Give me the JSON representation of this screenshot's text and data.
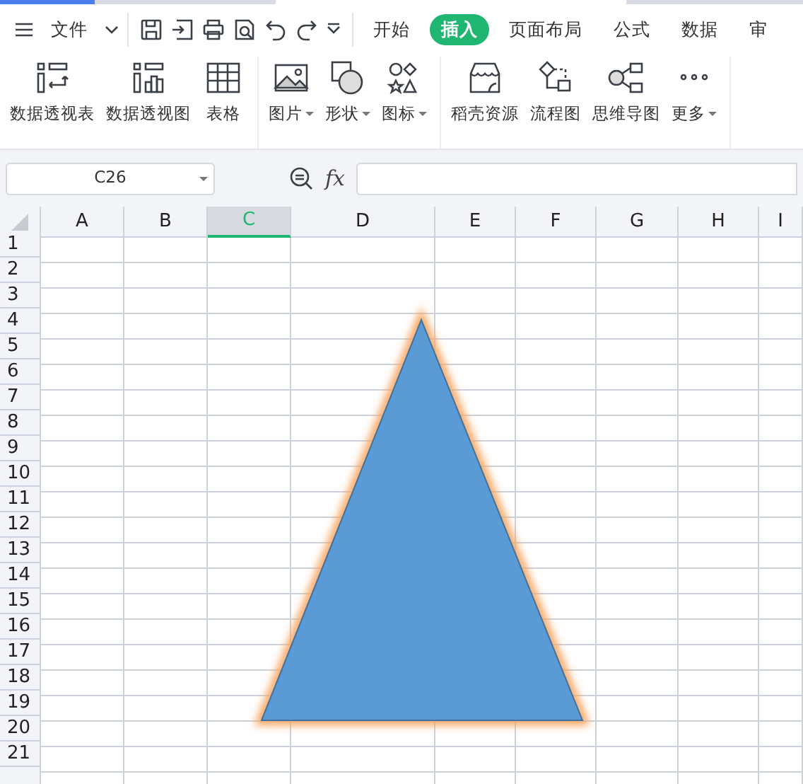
{
  "menu": {
    "label": "文件"
  },
  "tabs": [
    {
      "label": "开始",
      "selected": false
    },
    {
      "label": "插入",
      "selected": true
    },
    {
      "label": "页面布局",
      "selected": false
    },
    {
      "label": "公式",
      "selected": false
    },
    {
      "label": "数据",
      "selected": false
    },
    {
      "label": "审",
      "selected": false
    }
  ],
  "ribbon_groups": [
    {
      "items": [
        {
          "label": "数据透视表",
          "dropdown": false
        },
        {
          "label": "数据透视图",
          "dropdown": false
        },
        {
          "label": "表格",
          "dropdown": false
        }
      ]
    },
    {
      "items": [
        {
          "label": "图片",
          "dropdown": true
        },
        {
          "label": "形状",
          "dropdown": true
        },
        {
          "label": "图标",
          "dropdown": true
        }
      ]
    },
    {
      "items": [
        {
          "label": "稻壳资源",
          "dropdown": false
        },
        {
          "label": "流程图",
          "dropdown": false
        },
        {
          "label": "思维导图",
          "dropdown": false
        },
        {
          "label": "更多",
          "dropdown": true
        }
      ]
    }
  ],
  "name_box": {
    "value": "C26"
  },
  "function_label": "fx",
  "columns": [
    {
      "label": "A",
      "selected": false
    },
    {
      "label": "B",
      "selected": false
    },
    {
      "label": "C",
      "selected": true
    },
    {
      "label": "D",
      "selected": false
    },
    {
      "label": "E",
      "selected": false
    },
    {
      "label": "F",
      "selected": false
    },
    {
      "label": "G",
      "selected": false
    },
    {
      "label": "H",
      "selected": false
    },
    {
      "label": "I",
      "selected": false
    }
  ],
  "rows": [
    "1",
    "2",
    "3",
    "4",
    "5",
    "6",
    "7",
    "8",
    "9",
    "10",
    "11",
    "12",
    "13",
    "14",
    "15",
    "16",
    "17",
    "18",
    "19",
    "20",
    "21"
  ],
  "shape": {
    "kind": "triangle"
  }
}
